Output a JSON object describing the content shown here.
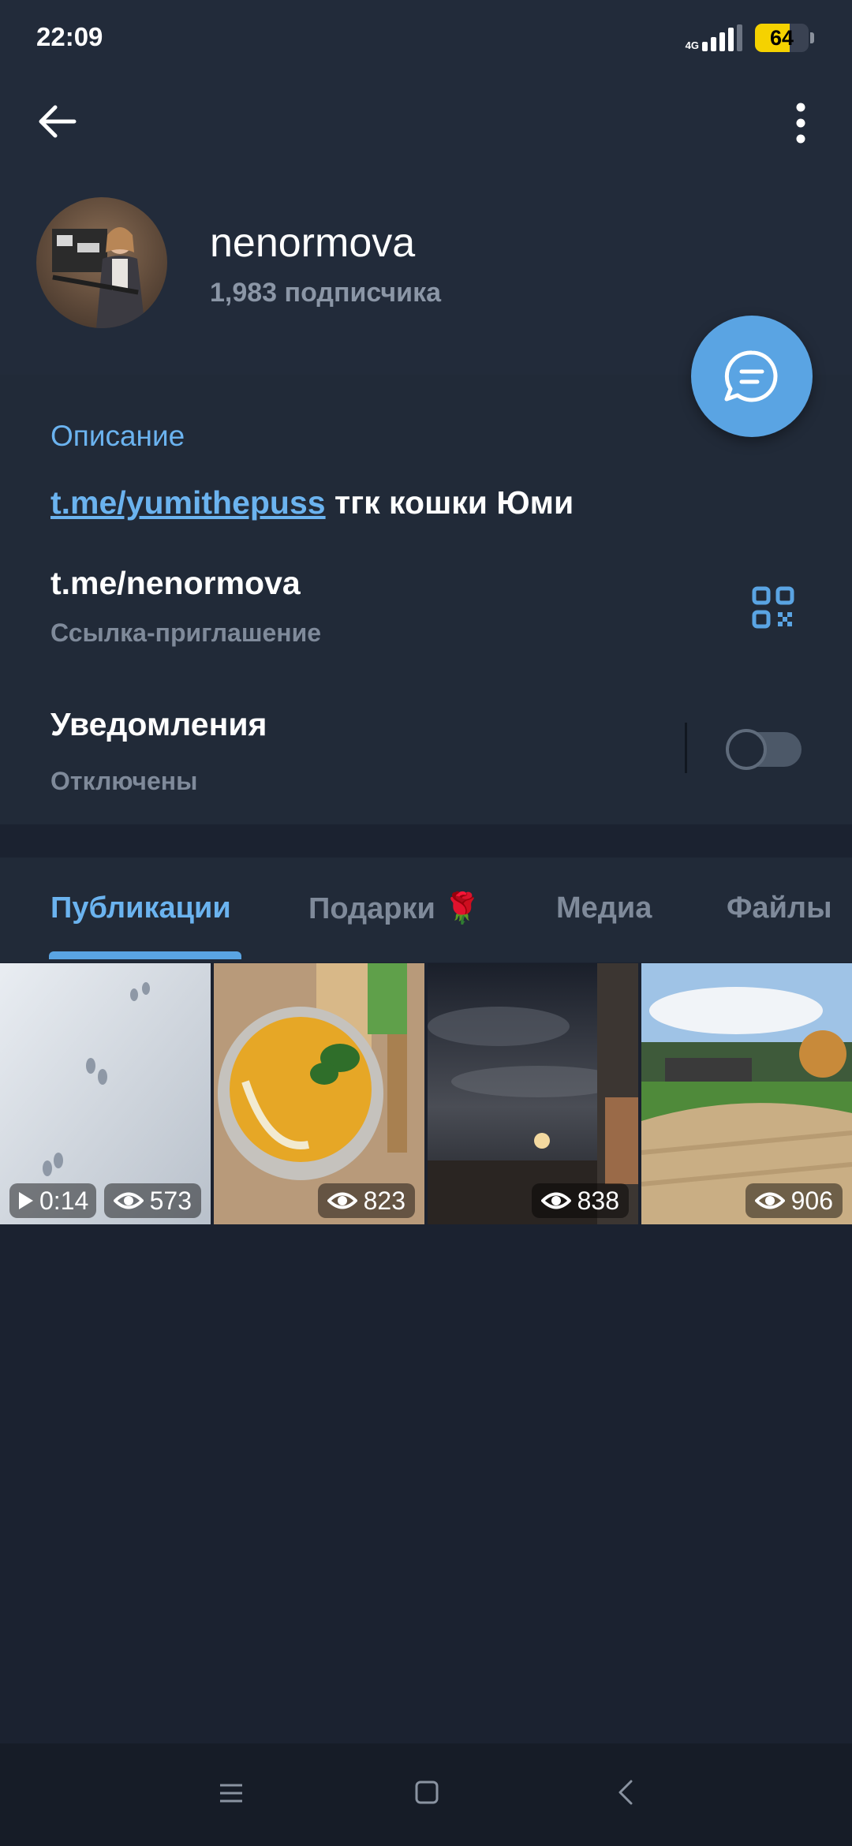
{
  "status_bar": {
    "time": "22:09",
    "network": "4G",
    "battery": "64",
    "battery_level": 0.64
  },
  "header": {
    "back_icon": "arrow-left-icon",
    "menu_icon": "more-vertical-icon",
    "channel_name": "nenormova",
    "subscribers": "1,983 подписчика",
    "fab_icon": "chat-bubble-icon"
  },
  "info": {
    "description_title": "Описание",
    "description_link": "t.me/yumithepuss",
    "description_text": " тгк кошки Юми",
    "invite_link": "t.me/nenormova",
    "invite_caption": "Ссылка-приглашение",
    "qr_icon": "qr-code-icon",
    "notifications_title": "Уведомления",
    "notifications_status": "Отключены",
    "notifications_enabled": false
  },
  "tabs": [
    {
      "label": "Публикации",
      "active": true
    },
    {
      "label": "Подарки 🌹",
      "active": false
    },
    {
      "label": "Медиа",
      "active": false
    },
    {
      "label": "Файлы",
      "active": false
    }
  ],
  "media": [
    {
      "duration": "0:14",
      "views": "573",
      "type": "video"
    },
    {
      "views": "823",
      "type": "photo"
    },
    {
      "views": "838",
      "type": "photo"
    },
    {
      "views": "906",
      "type": "photo"
    }
  ],
  "nav_bar": {
    "icons": [
      "menu-icon",
      "home-icon",
      "back-icon"
    ]
  },
  "colors": {
    "accent": "#5aa4e3",
    "header_bg": "#222b3a",
    "background": "#1b2230",
    "muted_text": "#7f8a9a"
  }
}
